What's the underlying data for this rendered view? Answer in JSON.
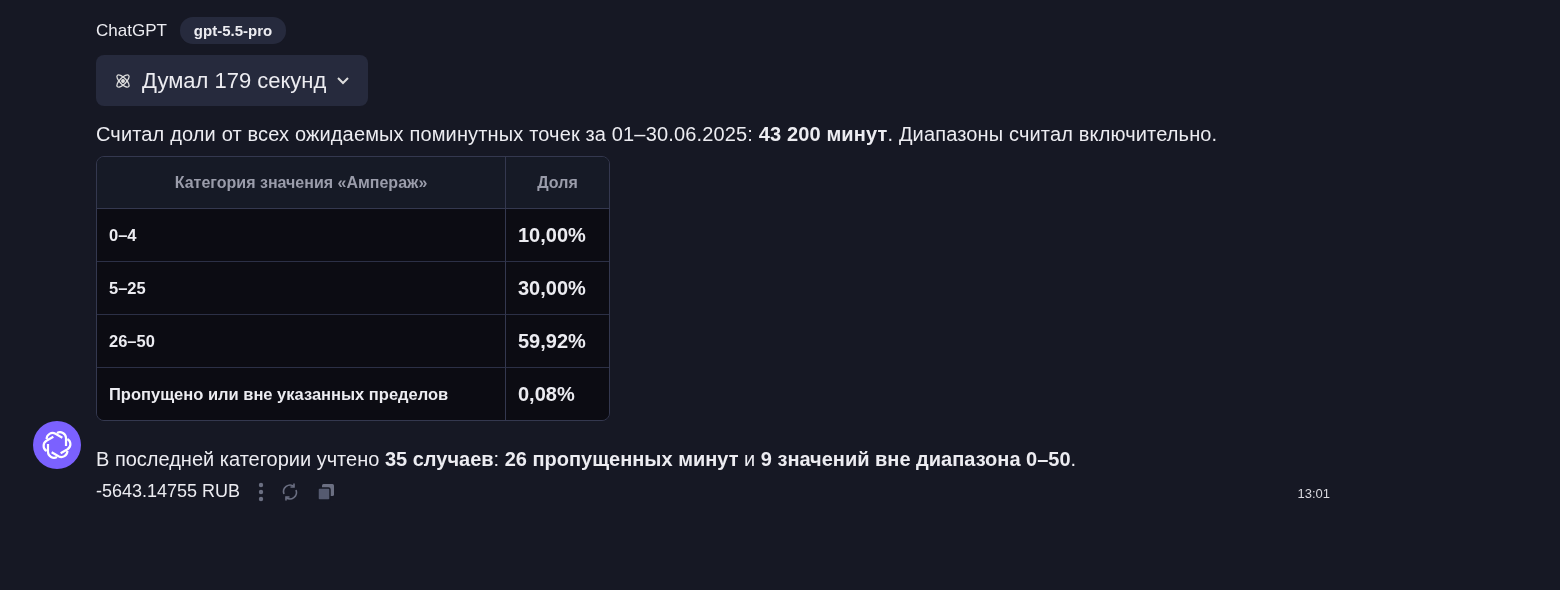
{
  "header": {
    "author": "ChatGPT",
    "model_badge": "gpt-5.5-pro"
  },
  "thinking_button": {
    "label": "Думал 179 секунд"
  },
  "intro": "Считал доли от всех ожидаемых поминутных точек за 01–30.06.2025: **43 200 минут**. Диапазоны считал включительно.",
  "table": {
    "columns": [
      "Категория значения «Ампераж»",
      "Доля"
    ],
    "rows": [
      {
        "category": "0–4",
        "share": "10,00%"
      },
      {
        "category": "5–25",
        "share": "30,00%"
      },
      {
        "category": "26–50",
        "share": "59,92%"
      },
      {
        "category": "Пропущено или вне указанных пределов",
        "share": "0,08%"
      }
    ]
  },
  "summary": "В последней категории учтено **35 случаев**: **26 пропущенных минут** и **9 значений вне диапазона 0–50**.",
  "footer": {
    "cost": "-5643.14755 RUB",
    "time": "13:01"
  }
}
